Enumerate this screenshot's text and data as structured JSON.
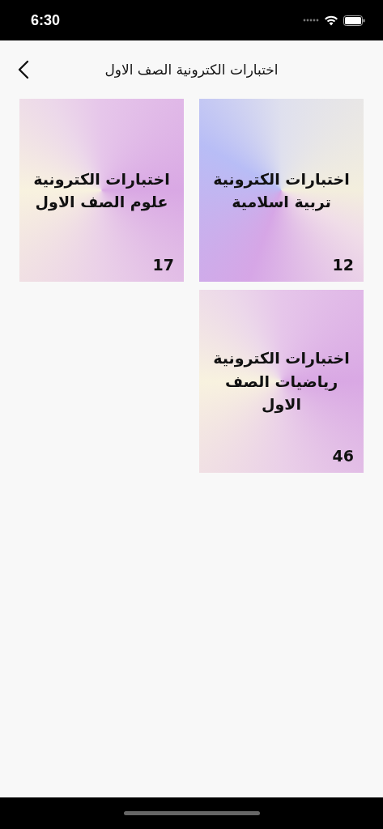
{
  "status_bar": {
    "time": "6:30"
  },
  "nav_bar": {
    "title": "اختبارات الكترونية الصف الاول"
  },
  "cards": [
    {
      "title": "اختبارات الكترونية تربية اسلامية",
      "count": "12"
    },
    {
      "title": "اختبارات الكترونية علوم الصف الاول",
      "count": "17"
    },
    {
      "title": "اختبارات الكترونية رياضيات الصف الاول",
      "count": "46"
    }
  ]
}
